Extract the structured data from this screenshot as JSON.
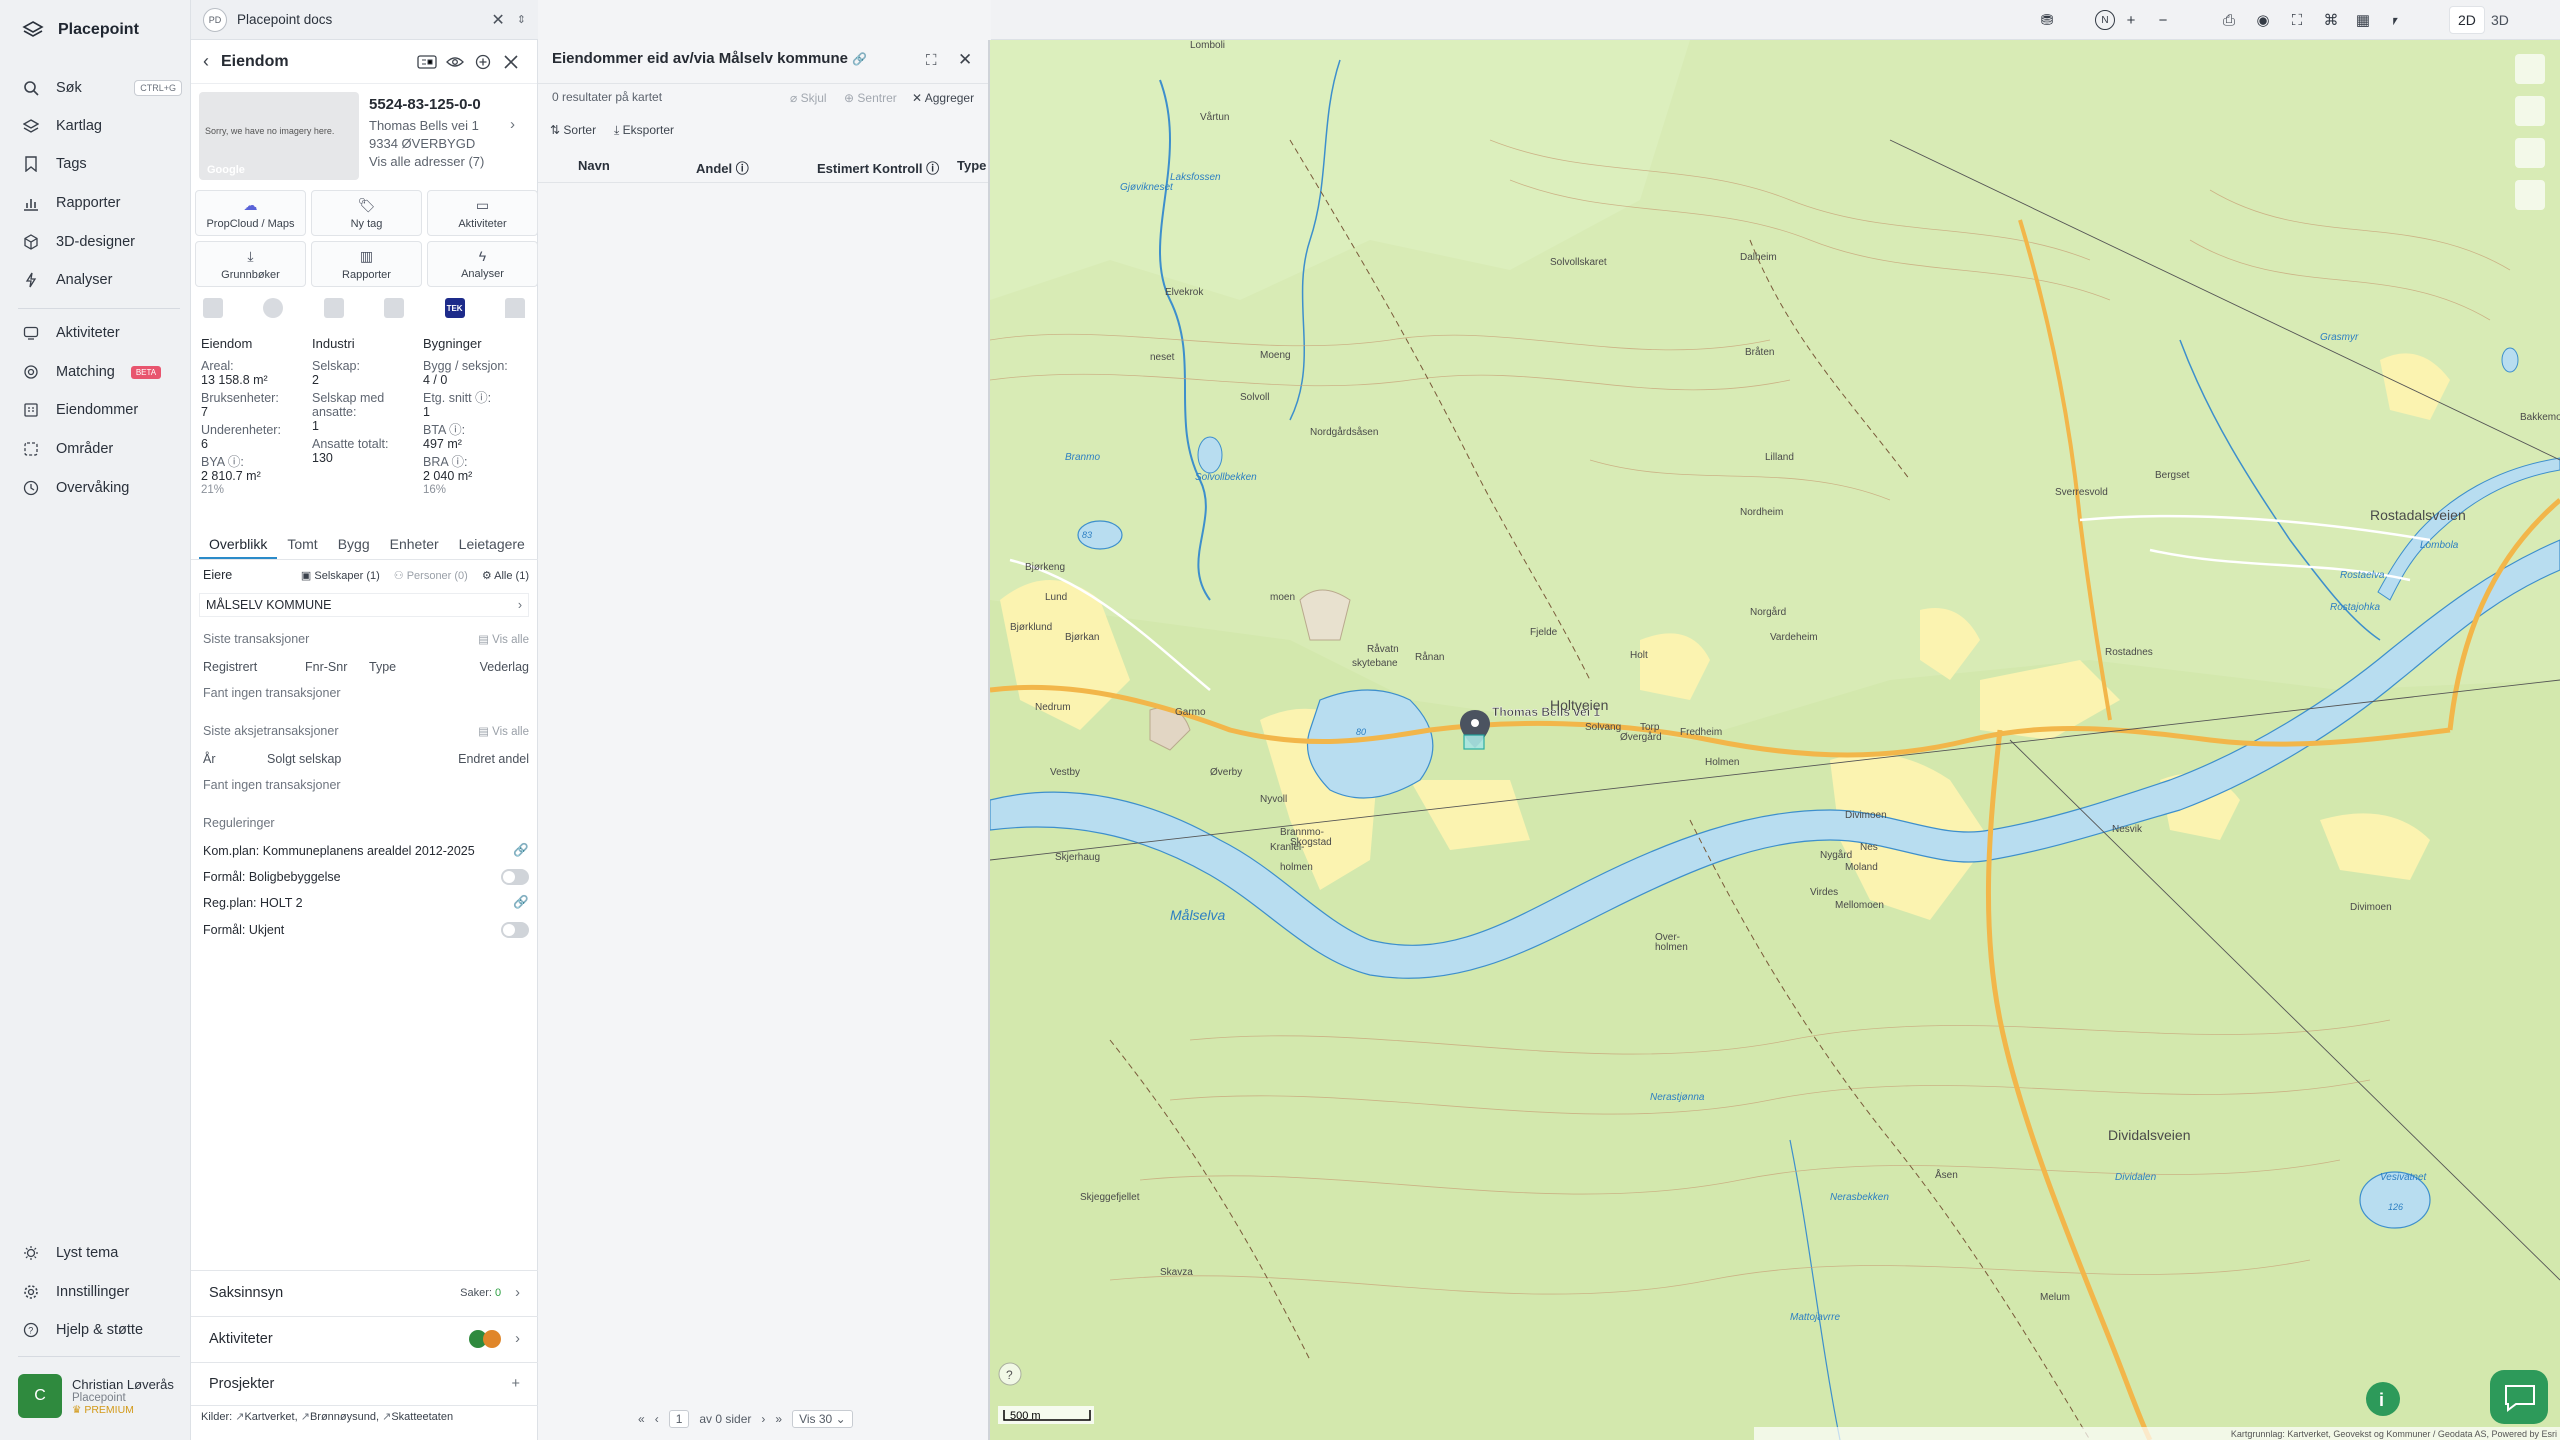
{
  "app": {
    "name": "Placepoint"
  },
  "nav": {
    "items": [
      {
        "label": "Søk",
        "icon": "search-icon",
        "shortcut": "CTRL+G"
      },
      {
        "label": "Kartlag",
        "icon": "layers-icon"
      },
      {
        "label": "Tags",
        "icon": "bookmark-icon"
      },
      {
        "label": "Rapporter",
        "icon": "bar-chart-icon"
      },
      {
        "label": "3D-designer",
        "icon": "cube-icon"
      },
      {
        "label": "Analyser",
        "icon": "bolt-icon"
      },
      {
        "label": "Aktiviteter",
        "icon": "activity-icon"
      },
      {
        "label": "Matching",
        "icon": "target-icon",
        "badge": "BETA"
      },
      {
        "label": "Eiendommer",
        "icon": "building-icon"
      },
      {
        "label": "Områder",
        "icon": "area-icon"
      },
      {
        "label": "Overvåking",
        "icon": "monitor-icon"
      }
    ],
    "bottom": [
      {
        "label": "Lyst tema",
        "icon": "sun-icon"
      },
      {
        "label": "Innstillinger",
        "icon": "gear-icon"
      },
      {
        "label": "Hjelp & støtte",
        "icon": "help-icon"
      }
    ],
    "user": {
      "initial": "C",
      "name": "Christian Løverås",
      "org": "Placepoint",
      "plan": "PREMIUM"
    }
  },
  "docs": {
    "badge": "PD",
    "title": "Placepoint docs"
  },
  "property": {
    "header": "Eiendom",
    "thumb_text": "Sorry, we have no imagery here.",
    "thumb_brand": "Google",
    "id": "5524-83-125-0-0",
    "address1": "Thomas Bells vei 1",
    "address2": "9334 ØVERBYGD",
    "all_addresses": "Vis alle adresser (7)",
    "actions": [
      {
        "label": "PropCloud / Maps",
        "icon": "cloud-icon"
      },
      {
        "label": "Ny tag",
        "icon": "bookmark-icon"
      },
      {
        "label": "Aktiviteter",
        "icon": "chat-icon"
      },
      {
        "label": "Grunnbøker",
        "icon": "download-icon"
      },
      {
        "label": "Rapporter",
        "icon": "bar-chart-icon"
      },
      {
        "label": "Analyser",
        "icon": "bolt-icon"
      }
    ],
    "source_badge": "TEK",
    "stats": {
      "col1": {
        "head": "Eiendom",
        "areal_l": "Areal:",
        "areal_v": "13 158.8 m²",
        "bruks_l": "Bruksenheter:",
        "bruks_v": "7",
        "under_l": "Underenheter:",
        "under_v": "6",
        "bya_l": "BYA ⓘ:",
        "bya_v": "2 810.7 m²",
        "bya_p": "21%"
      },
      "col2": {
        "head": "Industri",
        "selskap_l": "Selskap:",
        "selskap_v": "2",
        "med_l": "Selskap med ansatte:",
        "med_v": "1",
        "ans_l": "Ansatte totalt:",
        "ans_v": "130"
      },
      "col3": {
        "head": "Bygninger",
        "bygg_l": "Bygg / seksjon:",
        "bygg_v": "4 / 0",
        "etg_l": "Etg. snitt ⓘ:",
        "etg_v": "1",
        "bta_l": "BTA ⓘ:",
        "bta_v": "497 m²",
        "bra_l": "BRA ⓘ:",
        "bra_v": "2 040 m²",
        "bra_p": "16%"
      }
    },
    "tabs": [
      "Overblikk",
      "Tomt",
      "Bygg",
      "Enheter",
      "Leietagere"
    ],
    "owners": {
      "label": "Eiere",
      "f1": "Selskaper (1)",
      "f2": "Personer (0)",
      "f3": "Alle (1)",
      "owner": "MÅLSELV KOMMUNE"
    },
    "transactions": {
      "label": "Siste transaksjoner",
      "show_all": "Vis alle",
      "cols": [
        "Registrert",
        "Fnr-Snr",
        "Type",
        "Vederlag"
      ],
      "empty": "Fant ingen transaksjoner"
    },
    "stock": {
      "label": "Siste aksjetransaksjoner",
      "show_all": "Vis alle",
      "cols": [
        "År",
        "Solgt selskap",
        "Endret andel"
      ],
      "empty": "Fant ingen transaksjoner"
    },
    "regulations": {
      "label": "Reguleringer",
      "rows": [
        {
          "text": "Kom.plan: Kommuneplanens arealdel 2012-2025",
          "type": "link"
        },
        {
          "text": "Formål: Boligbebyggelse",
          "type": "toggle"
        },
        {
          "text": "Reg.plan: HOLT 2",
          "type": "link"
        },
        {
          "text": "Formål: Ukjent",
          "type": "toggle"
        }
      ]
    },
    "sections": {
      "saksinnsyn": "Saksinnsyn",
      "saker_label": "Saker:",
      "saker_count": "0",
      "aktiviteter": "Aktiviteter",
      "prosjekter": "Prosjekter"
    },
    "sources": {
      "label": "Kilder:",
      "items": [
        "Kartverket,",
        "Brønnøysund,",
        "Skatteetaten"
      ]
    }
  },
  "results": {
    "title": "Eiendommer eid av/via Målselv kommune",
    "count": "0 resultater på kartet",
    "skjul": "Skjul",
    "sentrer": "Sentrer",
    "aggreger": "Aggreger",
    "sorter": "Sorter",
    "eksporter": "Eksporter",
    "cols": [
      "Navn",
      "Andel ⓘ",
      "Estimert Kontroll ⓘ",
      "Type"
    ],
    "pager": {
      "page": "1",
      "of": "av 0 sider",
      "per": "Vis 30"
    }
  },
  "map": {
    "controls": {
      "d2": "2D",
      "d3": "3D",
      "compass": "N"
    },
    "scale": "500 m",
    "attribution": "Kartgrunnlag: Kartverket, Geovekst og Kommuner / Geodata AS, Powered by Esri",
    "marker_label": "Thomas Bells vei 1",
    "labels": [
      "Lomboli",
      "Vårtun",
      "Laksfossen",
      "Gjøvikneset",
      "Solvollskaret",
      "Elvekrok",
      "neset",
      "Moeng",
      "Solvoll",
      "Nordgårdsåsen",
      "Branmo",
      "Solvollbekken",
      "Bjørkeng",
      "Lund",
      "Bjørklund",
      "Bjørkan",
      "Nedrum",
      "Garmo",
      "Vestby",
      "Øverby",
      "Nyvoll",
      "Skogstad",
      "Skjerhaug",
      "Rånan",
      "moen",
      "Råvatn",
      "skytebane",
      "Fjelde",
      "Holt",
      "Holtveien",
      "Solvang",
      "Torp",
      "Øvergård",
      "Fredheim",
      "Holmen",
      "Divimoen",
      "Nes",
      "Moland",
      "Nygård",
      "Virdes",
      "Mellomoen",
      "Over-",
      "holmen",
      "Nesvik",
      "Dalheim",
      "Bråten",
      "Lilland",
      "Nordheim",
      "Norgård",
      "Vardeheim",
      "Rostadnes",
      "Sverresvold",
      "Bergset",
      "Bakkemo",
      "Grasmyr",
      "Rostadalsveien",
      "Rostaelva",
      "Rostajohka",
      "Lombola",
      "Dividalsveien",
      "Åsen",
      "Melum",
      "Skjeggefjellet",
      "Skavza",
      "Vesivatnet",
      "Dividalen",
      "Nerasbekken",
      "Målselva",
      "Kranlel-",
      "Brannmo-",
      "holmen",
      "Divimoen",
      "Nerastjønna",
      "Mattojavrre"
    ],
    "heights": [
      "83",
      "80",
      "126"
    ]
  }
}
